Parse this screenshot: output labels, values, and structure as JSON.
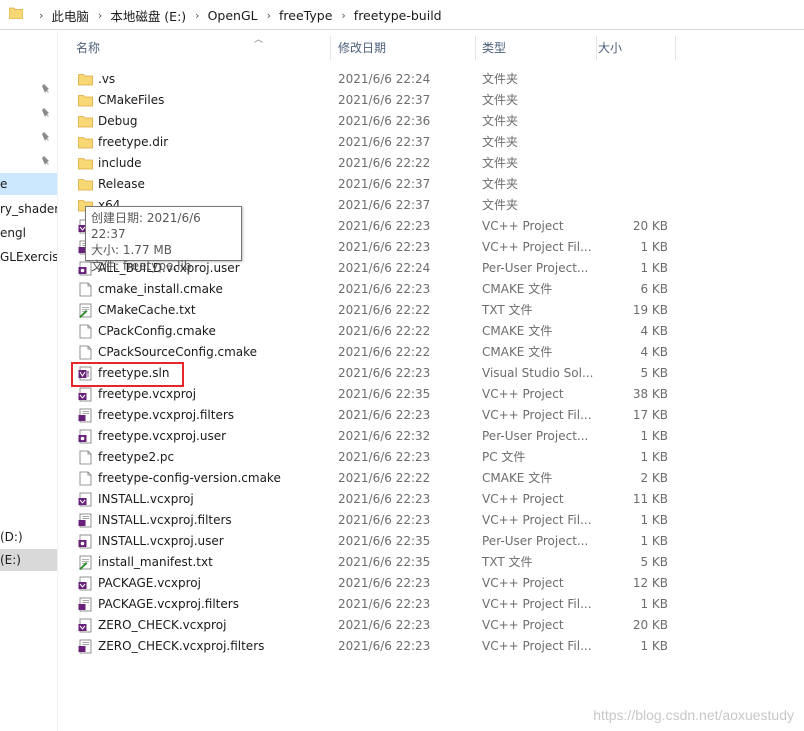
{
  "breadcrumb": [
    "此电脑",
    "本地磁盘 (E:)",
    "OpenGL",
    "freeType",
    "freetype-build"
  ],
  "columns": {
    "name": "名称",
    "date": "修改日期",
    "type": "类型",
    "size": "大小"
  },
  "nav": {
    "items": [
      "e",
      "ry_shader_",
      "engl",
      "GLExercis",
      "(D:)",
      "(E:)"
    ]
  },
  "files": [
    {
      "name": ".vs",
      "date": "2021/6/6 22:24",
      "type": "文件夹",
      "size": "",
      "icon": "folder-icon"
    },
    {
      "name": "CMakeFiles",
      "date": "2021/6/6 22:37",
      "type": "文件夹",
      "size": "",
      "icon": "folder-icon"
    },
    {
      "name": "Debug",
      "date": "2021/6/6 22:36",
      "type": "文件夹",
      "size": "",
      "icon": "folder-icon"
    },
    {
      "name": "freetype.dir",
      "date": "2021/6/6 22:37",
      "type": "文件夹",
      "size": "",
      "icon": "folder-icon"
    },
    {
      "name": "include",
      "date": "2021/6/6 22:22",
      "type": "文件夹",
      "size": "",
      "icon": "folder-icon"
    },
    {
      "name": "Release",
      "date": "2021/6/6 22:37",
      "type": "文件夹",
      "size": "",
      "icon": "folder-icon"
    },
    {
      "name": "x64",
      "date": "2021/6/6 22:37",
      "type": "文件夹",
      "size": "",
      "icon": "folder-icon"
    },
    {
      "name": "",
      "date": "2021/6/6 22:23",
      "type": "VC++ Project",
      "size": "20 KB",
      "icon": "vcxproj-icon"
    },
    {
      "name": "",
      "date": "2021/6/6 22:23",
      "type": "VC++ Project Fil...",
      "size": "1 KB",
      "icon": "filters-icon"
    },
    {
      "name": "ALL_BUILD.vcxproj.user",
      "date": "2021/6/6 22:24",
      "type": "Per-User Project...",
      "size": "1 KB",
      "icon": "user-icon"
    },
    {
      "name": "cmake_install.cmake",
      "date": "2021/6/6 22:23",
      "type": "CMAKE 文件",
      "size": "6 KB",
      "icon": "file-icon"
    },
    {
      "name": "CMakeCache.txt",
      "date": "2021/6/6 22:22",
      "type": "TXT 文件",
      "size": "19 KB",
      "icon": "txt-icon"
    },
    {
      "name": "CPackConfig.cmake",
      "date": "2021/6/6 22:22",
      "type": "CMAKE 文件",
      "size": "4 KB",
      "icon": "file-icon"
    },
    {
      "name": "CPackSourceConfig.cmake",
      "date": "2021/6/6 22:22",
      "type": "CMAKE 文件",
      "size": "4 KB",
      "icon": "file-icon"
    },
    {
      "name": "freetype.sln",
      "date": "2021/6/6 22:23",
      "type": "Visual Studio Sol...",
      "size": "5 KB",
      "icon": "sln-icon"
    },
    {
      "name": "freetype.vcxproj",
      "date": "2021/6/6 22:35",
      "type": "VC++ Project",
      "size": "38 KB",
      "icon": "vcxproj-icon"
    },
    {
      "name": "freetype.vcxproj.filters",
      "date": "2021/6/6 22:23",
      "type": "VC++ Project Fil...",
      "size": "17 KB",
      "icon": "filters-icon"
    },
    {
      "name": "freetype.vcxproj.user",
      "date": "2021/6/6 22:32",
      "type": "Per-User Project...",
      "size": "1 KB",
      "icon": "user-icon"
    },
    {
      "name": "freetype2.pc",
      "date": "2021/6/6 22:23",
      "type": "PC 文件",
      "size": "1 KB",
      "icon": "file-icon"
    },
    {
      "name": "freetype-config-version.cmake",
      "date": "2021/6/6 22:22",
      "type": "CMAKE 文件",
      "size": "2 KB",
      "icon": "file-icon"
    },
    {
      "name": "INSTALL.vcxproj",
      "date": "2021/6/6 22:23",
      "type": "VC++ Project",
      "size": "11 KB",
      "icon": "vcxproj-icon"
    },
    {
      "name": "INSTALL.vcxproj.filters",
      "date": "2021/6/6 22:23",
      "type": "VC++ Project Fil...",
      "size": "1 KB",
      "icon": "filters-icon"
    },
    {
      "name": "INSTALL.vcxproj.user",
      "date": "2021/6/6 22:35",
      "type": "Per-User Project...",
      "size": "1 KB",
      "icon": "user-icon"
    },
    {
      "name": "install_manifest.txt",
      "date": "2021/6/6 22:35",
      "type": "TXT 文件",
      "size": "5 KB",
      "icon": "txt-icon"
    },
    {
      "name": "PACKAGE.vcxproj",
      "date": "2021/6/6 22:23",
      "type": "VC++ Project",
      "size": "12 KB",
      "icon": "vcxproj-icon"
    },
    {
      "name": "PACKAGE.vcxproj.filters",
      "date": "2021/6/6 22:23",
      "type": "VC++ Project Fil...",
      "size": "1 KB",
      "icon": "filters-icon"
    },
    {
      "name": "ZERO_CHECK.vcxproj",
      "date": "2021/6/6 22:23",
      "type": "VC++ Project",
      "size": "20 KB",
      "icon": "vcxproj-icon"
    },
    {
      "name": "ZERO_CHECK.vcxproj.filters",
      "date": "2021/6/6 22:23",
      "type": "VC++ Project Fil...",
      "size": "1 KB",
      "icon": "filters-icon"
    }
  ],
  "tooltip": {
    "created": "创建日期: 2021/6/6 22:37",
    "size": "大小: 1.77 MB",
    "files": "文件: freetype.lib"
  },
  "watermark": "https://blog.csdn.net/aoxuestudy"
}
